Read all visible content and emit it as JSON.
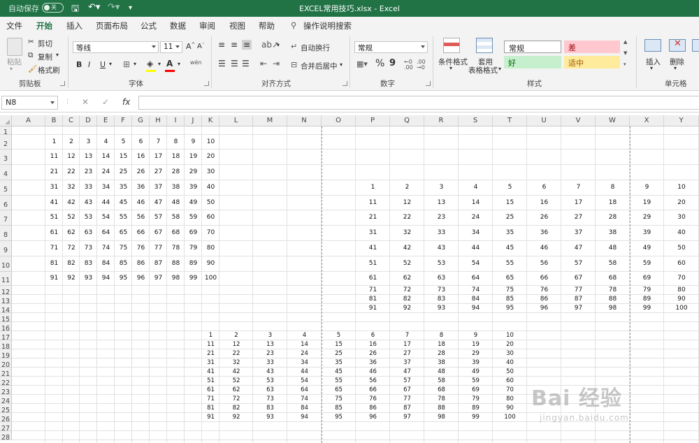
{
  "titlebar": {
    "autosave_label": "自动保存",
    "autosave_state": "关",
    "title": "EXCEL常用技巧.xlsx  -  Excel"
  },
  "tabs": [
    "文件",
    "开始",
    "插入",
    "页面布局",
    "公式",
    "数据",
    "审阅",
    "视图",
    "帮助",
    "操作说明搜索"
  ],
  "active_tab": "开始",
  "ribbon": {
    "clipboard": {
      "paste": "粘贴",
      "cut": "剪切",
      "copy": "复制",
      "format_painter": "格式刷",
      "label": "剪贴板"
    },
    "font": {
      "name": "等线",
      "size": "11",
      "bold": "B",
      "italic": "I",
      "underline": "U",
      "label": "字体",
      "grow": "A",
      "shrink": "A",
      "wen": "wén"
    },
    "alignment": {
      "wrap": "自动换行",
      "merge": "合并后居中",
      "label": "对齐方式"
    },
    "number": {
      "format": "常规",
      "percent": "%",
      "comma": "9",
      "label": "数字"
    },
    "styles": {
      "conditional": "条件格式",
      "table_line1": "套用",
      "table_line2": "表格格式",
      "normal": "常规",
      "bad": "差",
      "good": "好",
      "neutral": "适中",
      "label": "样式"
    },
    "cells": {
      "insert": "插入",
      "delete": "删除",
      "label": "单元格"
    }
  },
  "formula_bar": {
    "name_box": "N8",
    "cancel": "✕",
    "enter": "✓",
    "fx": "fx",
    "value": ""
  },
  "columns": [
    "A",
    "B",
    "C",
    "D",
    "E",
    "F",
    "G",
    "H",
    "I",
    "J",
    "K",
    "L",
    "M",
    "N",
    "O",
    "P",
    "Q",
    "R",
    "S",
    "T",
    "U",
    "V",
    "W",
    "X",
    "Y"
  ],
  "rows": [
    "1",
    "2",
    "3",
    "4",
    "5",
    "6",
    "7",
    "8",
    "9",
    "10",
    "11",
    "12",
    "13",
    "14",
    "15",
    "16",
    "17",
    "18",
    "19",
    "20",
    "21",
    "22",
    "23",
    "24",
    "25",
    "26",
    "27",
    "28"
  ],
  "tables": {
    "table1": [
      [
        "1",
        "2",
        "3",
        "4",
        "5",
        "6",
        "7",
        "8",
        "9",
        "10"
      ],
      [
        "11",
        "12",
        "13",
        "14",
        "15",
        "16",
        "17",
        "18",
        "19",
        "20"
      ],
      [
        "21",
        "22",
        "23",
        "24",
        "25",
        "26",
        "27",
        "28",
        "29",
        "30"
      ],
      [
        "31",
        "32",
        "33",
        "34",
        "35",
        "36",
        "37",
        "38",
        "39",
        "40"
      ],
      [
        "41",
        "42",
        "43",
        "44",
        "45",
        "46",
        "47",
        "48",
        "49",
        "50"
      ],
      [
        "51",
        "52",
        "53",
        "54",
        "55",
        "56",
        "57",
        "58",
        "59",
        "60"
      ],
      [
        "61",
        "62",
        "63",
        "64",
        "65",
        "66",
        "67",
        "68",
        "69",
        "70"
      ],
      [
        "71",
        "72",
        "73",
        "74",
        "75",
        "76",
        "77",
        "78",
        "79",
        "80"
      ],
      [
        "81",
        "82",
        "83",
        "84",
        "85",
        "86",
        "87",
        "88",
        "89",
        "90"
      ],
      [
        "91",
        "92",
        "93",
        "94",
        "95",
        "96",
        "97",
        "98",
        "99",
        "100"
      ]
    ],
    "table2": [
      [
        "1",
        "2",
        "3",
        "4",
        "5",
        "6",
        "7",
        "8",
        "9",
        "10"
      ],
      [
        "11",
        "12",
        "13",
        "14",
        "15",
        "16",
        "17",
        "18",
        "19",
        "20"
      ],
      [
        "21",
        "22",
        "23",
        "24",
        "25",
        "26",
        "27",
        "28",
        "29",
        "30"
      ],
      [
        "31",
        "32",
        "33",
        "34",
        "35",
        "36",
        "37",
        "38",
        "39",
        "40"
      ],
      [
        "41",
        "42",
        "43",
        "44",
        "45",
        "46",
        "47",
        "48",
        "49",
        "50"
      ],
      [
        "51",
        "52",
        "53",
        "54",
        "55",
        "56",
        "57",
        "58",
        "59",
        "60"
      ],
      [
        "61",
        "62",
        "63",
        "64",
        "65",
        "66",
        "67",
        "68",
        "69",
        "70"
      ],
      [
        "71",
        "72",
        "73",
        "74",
        "75",
        "76",
        "77",
        "78",
        "79",
        "80"
      ],
      [
        "81",
        "82",
        "83",
        "84",
        "85",
        "86",
        "87",
        "88",
        "89",
        "90"
      ],
      [
        "91",
        "92",
        "93",
        "94",
        "95",
        "96",
        "97",
        "98",
        "99",
        "100"
      ]
    ],
    "table3": [
      [
        "1",
        "2",
        "3",
        "4",
        "5",
        "6",
        "7",
        "8",
        "9",
        "10"
      ],
      [
        "11",
        "12",
        "13",
        "14",
        "15",
        "16",
        "17",
        "18",
        "19",
        "20"
      ],
      [
        "21",
        "22",
        "23",
        "24",
        "25",
        "26",
        "27",
        "28",
        "29",
        "30"
      ],
      [
        "31",
        "32",
        "33",
        "34",
        "35",
        "36",
        "37",
        "38",
        "39",
        "40"
      ],
      [
        "41",
        "42",
        "43",
        "44",
        "45",
        "46",
        "47",
        "48",
        "49",
        "50"
      ],
      [
        "51",
        "52",
        "53",
        "54",
        "55",
        "56",
        "57",
        "58",
        "59",
        "60"
      ],
      [
        "61",
        "62",
        "63",
        "64",
        "65",
        "66",
        "67",
        "68",
        "69",
        "70"
      ],
      [
        "71",
        "72",
        "73",
        "74",
        "75",
        "76",
        "77",
        "78",
        "79",
        "80"
      ],
      [
        "81",
        "82",
        "83",
        "84",
        "85",
        "86",
        "87",
        "88",
        "89",
        "90"
      ],
      [
        "91",
        "92",
        "93",
        "94",
        "95",
        "96",
        "97",
        "98",
        "99",
        "100"
      ]
    ]
  },
  "watermark": {
    "brand": "Bai 经验",
    "url": "jingyan.baidu.com"
  },
  "colors": {
    "excel_green": "#217346",
    "bad_bg": "#ffc7ce",
    "good_bg": "#c6efce",
    "neutral_bg": "#ffeb9c"
  }
}
